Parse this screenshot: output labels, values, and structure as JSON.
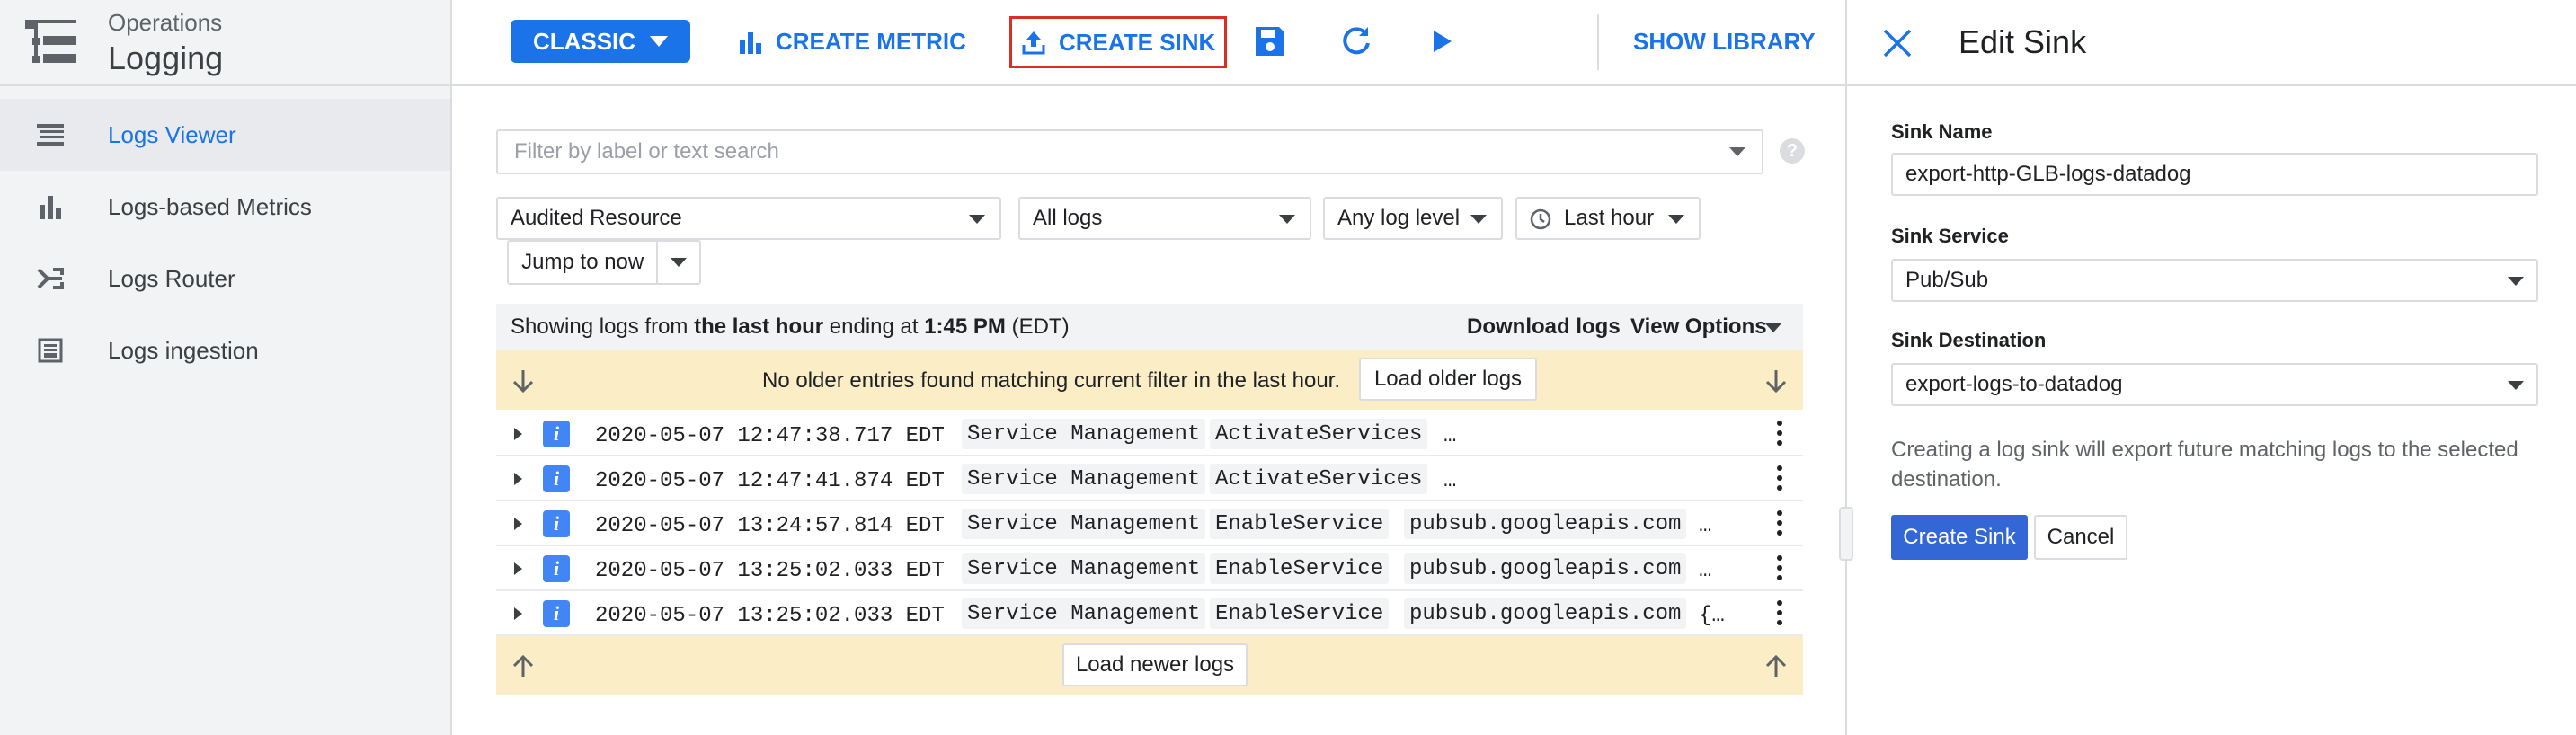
{
  "brand": {
    "product": "Operations",
    "page": "Logging",
    "icon": "logging-list-icon"
  },
  "sidebar": {
    "items": [
      {
        "label": "Logs Viewer",
        "icon": "logs-viewer-icon",
        "active": true
      },
      {
        "label": "Logs-based Metrics",
        "icon": "bar-chart-icon",
        "active": false
      },
      {
        "label": "Logs Router",
        "icon": "router-icon",
        "active": false
      },
      {
        "label": "Logs ingestion",
        "icon": "ingestion-icon",
        "active": false
      }
    ]
  },
  "toolbar": {
    "classic_label": "CLASSIC",
    "create_metric_label": "CREATE METRIC",
    "create_sink_label": "CREATE SINK",
    "show_library_label": "SHOW LIBRARY",
    "icons": [
      "save-icon",
      "refresh-icon",
      "play-icon"
    ]
  },
  "filter": {
    "placeholder": "Filter by label or text search"
  },
  "selectors": {
    "resource": "Audited Resource",
    "logs": "All logs",
    "level": "Any log level",
    "time": "Last hour",
    "jump": "Jump to now"
  },
  "status": {
    "prefix": "Showing logs from ",
    "range": "the last hour",
    "middle": " ending at ",
    "time": "1:45 PM",
    "suffix": " (EDT)",
    "download": "Download logs",
    "view_options": "View Options"
  },
  "older": {
    "message": "No older entries found matching current filter in the last hour.",
    "button": "Load older logs"
  },
  "newer": {
    "button": "Load newer logs"
  },
  "logs": [
    {
      "severity": "i",
      "timestamp": "2020-05-07 12:47:38.717 EDT",
      "service": "Service Management",
      "method": "ActivateServices",
      "resource": "",
      "tail": "…"
    },
    {
      "severity": "i",
      "timestamp": "2020-05-07 12:47:41.874 EDT",
      "service": "Service Management",
      "method": "ActivateServices",
      "resource": "",
      "tail": "…"
    },
    {
      "severity": "i",
      "timestamp": "2020-05-07 13:24:57.814 EDT",
      "service": "Service Management",
      "method": "EnableService",
      "resource": "pubsub.googleapis.com",
      "tail": "…"
    },
    {
      "severity": "i",
      "timestamp": "2020-05-07 13:25:02.033 EDT",
      "service": "Service Management",
      "method": "EnableService",
      "resource": "pubsub.googleapis.com",
      "tail": "…"
    },
    {
      "severity": "i",
      "timestamp": "2020-05-07 13:25:02.033 EDT",
      "service": "Service Management",
      "method": "EnableService",
      "resource": "pubsub.googleapis.com",
      "tail": "{…"
    }
  ],
  "panel": {
    "title": "Edit Sink",
    "name_label": "Sink Name",
    "name_value": "export-http-GLB-logs-datadog",
    "service_label": "Sink Service",
    "service_value": "Pub/Sub",
    "dest_label": "Sink Destination",
    "dest_value": "export-logs-to-datadog",
    "help": "Creating a log sink will export future matching logs to the selected destination.",
    "create_label": "Create Sink",
    "cancel_label": "Cancel"
  },
  "colors": {
    "accent": "#1a73e8",
    "primary_button": "#3367d6",
    "highlight_border": "#d93025",
    "banner": "#fbeec6",
    "sidebar_bg": "#f1f3f4"
  }
}
